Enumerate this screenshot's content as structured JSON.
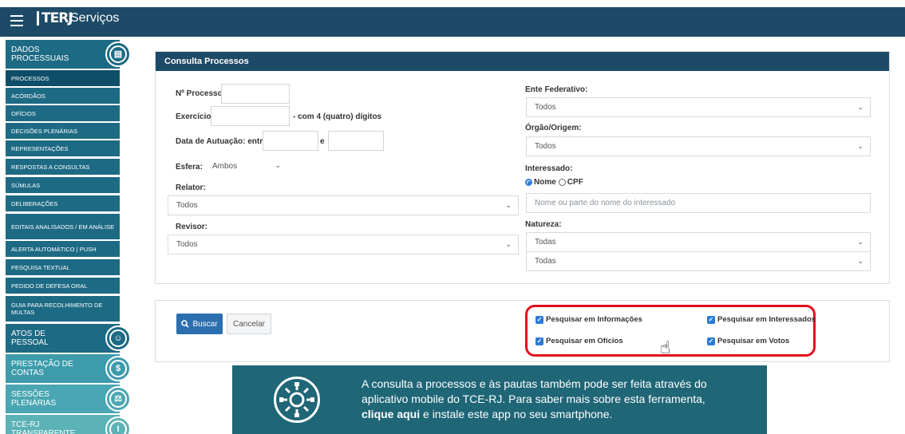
{
  "topbar": {
    "logo_text": "TERJ",
    "app_name": "Serviços"
  },
  "sidebar": {
    "categories": [
      {
        "label": "DADOS PROCESSUAIS",
        "icon": "document-icon"
      },
      {
        "label": "ATOS DE PESSOAL",
        "icon": "person-icon"
      },
      {
        "label": "PRESTAÇÃO DE CONTAS",
        "icon": "accounts-icon"
      },
      {
        "label": "SESSÕES PLENÁRIAS",
        "icon": "gavel-icon"
      },
      {
        "label": "TCE-RJ TRANSPARENTE",
        "icon": "info-icon"
      }
    ],
    "items": [
      "PROCESSOS",
      "ACÓRDÃOS",
      "OFÍCIOS",
      "DECISÕES PLENÁRIAS",
      "REPRESENTAÇÕES",
      "RESPOSTAS A CONSULTAS",
      "SÚMULAS",
      "DELIBERAÇÕES",
      "EDITAIS ANALISADOS / EM ANÁLISE",
      "ALERTA AUTOMÁTICO | PUSH",
      "PESQUISA TEXTUAL",
      "PEDIDO DE DEFESA ORAL",
      "GUIA PARA RECOLHIMENTO DE MULTAS"
    ]
  },
  "form": {
    "title": "Consulta Processos",
    "processo_label": "Nº Processo:",
    "exercicio_label": "Exercício:",
    "exercicio_hint": "- com 4 (quatro) dígitos",
    "data_label": "Data de Autuação: entre",
    "data_and": "e",
    "esfera_label": "Esfera:",
    "esfera_value": "Ambos",
    "relator_label": "Relator:",
    "relator_value": "Todos",
    "revisor_label": "Revisor:",
    "revisor_value": "Todos",
    "ente_label": "Ente Federativo:",
    "ente_value": "Todos",
    "orgao_label": "Órgão/Origem:",
    "orgao_value": "Todos",
    "interessado_label": "Interessado:",
    "radio_nome": "Nome",
    "radio_cpf": "CPF",
    "interessado_placeholder": "Nome ou parte do nome do interessado",
    "natureza_label": "Natureza:",
    "natureza_value1": "Todas",
    "natureza_value2": "Todas"
  },
  "actions": {
    "buscar": "Buscar",
    "cancelar": "Cancelar",
    "chk_informacoes": "Pesquisar em Informações",
    "chk_interessados": "Pesquisar em Interessados",
    "chk_oficios": "Pesquisar em Ofícios",
    "chk_votos": "Pesquisar em Votos"
  },
  "banner": {
    "line1": "A consulta a processos e às pautas também pode ser feita através do",
    "line2": "aplicativo mobile do TCE-RJ. Para saber mais sobre esta ferramenta,",
    "link": "clique aqui",
    "line3": " e instale este app no seu smartphone."
  },
  "colors": {
    "header": "#1d4a66",
    "sidebar": "#1d6a84",
    "button": "#2c6fae",
    "highlight": "#e1101d",
    "banner": "#1f6677"
  }
}
